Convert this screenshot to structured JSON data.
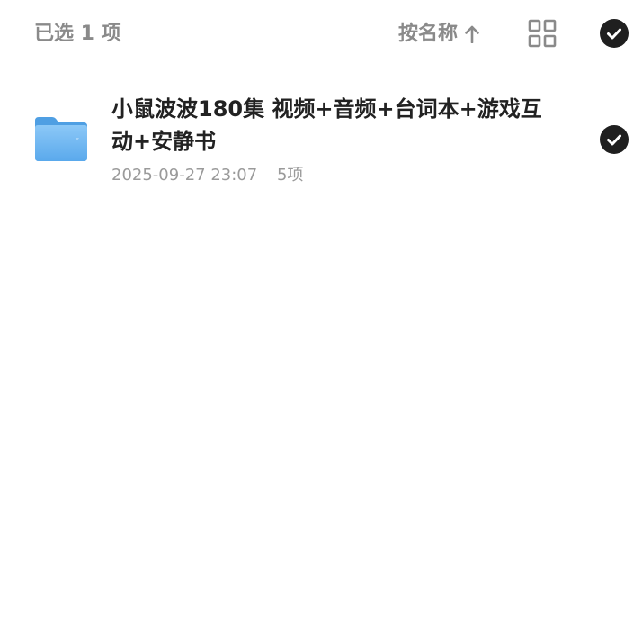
{
  "toolbar": {
    "selected_label": "已选 1 项",
    "sort_label": "按名称",
    "sort_icon": "arrow-up-icon",
    "view_icon": "grid-view-icon",
    "select_all_icon": "check-circle-icon"
  },
  "files": [
    {
      "name": "小鼠波波180集 视频+音频+台词本+游戏互动+安静书",
      "date": "2025-09-27 23:07",
      "count": "5项",
      "icon": "folder-icon",
      "selected": true
    }
  ],
  "colors": {
    "muted_text": "#8a8a8a",
    "primary_text": "#222222",
    "check_fill": "#1f1f1f",
    "folder_blue": "#69b3f2"
  }
}
